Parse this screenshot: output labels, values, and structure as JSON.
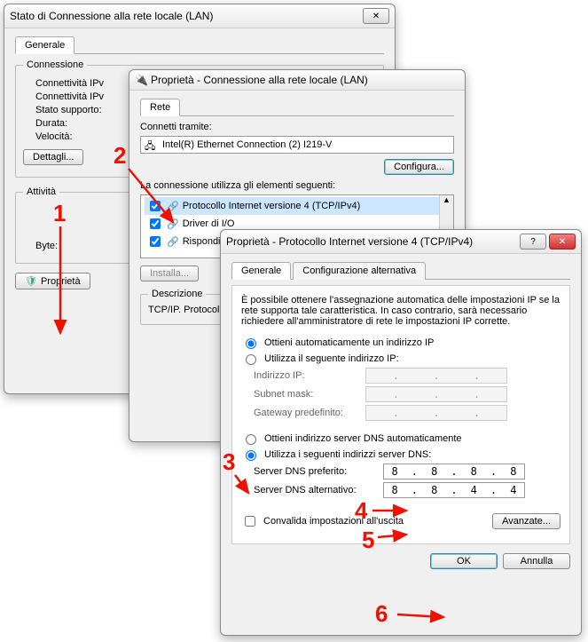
{
  "win1": {
    "title": "Stato di Connessione alla rete locale (LAN)",
    "tab_general": "Generale",
    "group_conn": "Connessione",
    "lbl_ipv4": "Connettività IPv",
    "lbl_ipv6": "Connettività IPv",
    "lbl_state": "Stato supporto:",
    "lbl_duration": "Durata:",
    "lbl_speed": "Velocità:",
    "btn_details": "Dettagli...",
    "group_act": "Attività",
    "lbl_bytes": "Byte:",
    "btn_props": "Proprietà"
  },
  "win2": {
    "title": "Proprietà - Connessione alla rete locale (LAN)",
    "tab_net": "Rete",
    "lbl_connect": "Connetti tramite:",
    "adapter": "Intel(R) Ethernet Connection (2) I219-V",
    "btn_config": "Configura...",
    "lbl_uses": "La connessione utilizza gli elementi seguenti:",
    "item_tcpip4": "Protocollo Internet versione 4 (TCP/IPv4)",
    "item_driver": "Driver di I/O",
    "item_responder": "Risponditore",
    "btn_install": "Installa...",
    "group_desc": "Descrizione",
    "desc_text": "TCP/IP. Protocollo comunicazione tra"
  },
  "win3": {
    "title": "Proprietà - Protocollo Internet versione 4 (TCP/IPv4)",
    "tab_general": "Generale",
    "tab_alt": "Configurazione alternativa",
    "intro": "È possibile ottenere l'assegnazione automatica delle impostazioni IP se la rete supporta tale caratteristica. In caso contrario, sarà necessario richiedere all'amministratore di rete le impostazioni IP corrette.",
    "radio_auto_ip": "Ottieni automaticamente un indirizzo IP",
    "radio_manual_ip": "Utilizza il seguente indirizzo IP:",
    "lbl_ip": "Indirizzo IP:",
    "lbl_mask": "Subnet mask:",
    "lbl_gw": "Gateway predefinito:",
    "radio_auto_dns": "Ottieni indirizzo server DNS automaticamente",
    "radio_manual_dns": "Utilizza i seguenti indirizzi server DNS:",
    "lbl_dns1": "Server DNS preferito:",
    "lbl_dns2": "Server DNS alternativo:",
    "dns1": {
      "a": "8",
      "b": "8",
      "c": "8",
      "d": "8"
    },
    "dns2": {
      "a": "8",
      "b": "8",
      "c": "4",
      "d": "4"
    },
    "chk_validate": "Convalida impostazioni all'uscita",
    "btn_adv": "Avanzate...",
    "btn_ok": "OK",
    "btn_cancel": "Annulla"
  },
  "annotations": {
    "n1": "1",
    "n2": "2",
    "n3": "3",
    "n4": "4",
    "n5": "5",
    "n6": "6"
  }
}
